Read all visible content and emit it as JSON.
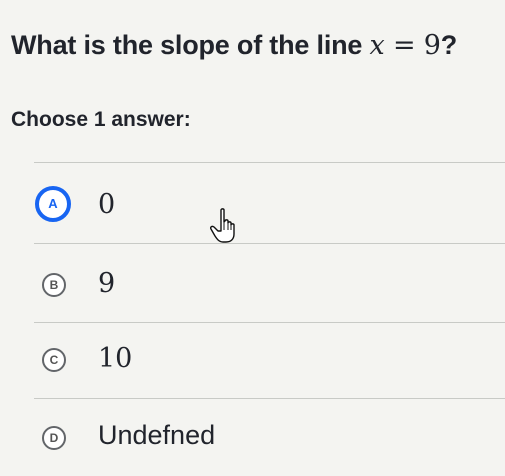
{
  "question": {
    "prefix": "What is the slope of the line ",
    "math_var": "x",
    "math_eq": " = ",
    "math_val": "9",
    "suffix": "?"
  },
  "prompt": "Choose 1 answer:",
  "options": [
    {
      "letter": "A",
      "text": "0",
      "selected": true
    },
    {
      "letter": "B",
      "text": "9",
      "selected": false
    },
    {
      "letter": "C",
      "text": "10",
      "selected": false
    },
    {
      "letter": "D",
      "text": "Undefned",
      "selected": false
    }
  ],
  "colors": {
    "accent": "#1865f2",
    "text": "#21242c",
    "divider": "#c8cac6"
  },
  "icons": {
    "cursor": "pointer-hand-icon"
  }
}
